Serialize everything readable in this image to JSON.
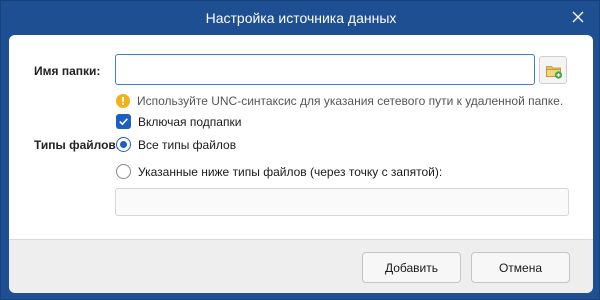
{
  "window": {
    "title": "Настройка источника данных"
  },
  "folder": {
    "label": "Имя папки:",
    "value": "",
    "placeholder": ""
  },
  "hint": {
    "text": "Используйте UNC-синтаксис для указания сетевого пути к удаленной папке."
  },
  "include_subfolders": {
    "label": "Включая подпапки",
    "checked": true
  },
  "file_types": {
    "label": "Типы файлов:",
    "option_all": "Все типы файлов",
    "option_specified": "Указанные ниже типы файлов (через точку с запятой):",
    "selected": "all",
    "specified_value": ""
  },
  "footer": {
    "add_label": "Добавить",
    "cancel_label": "Отмена"
  },
  "colors": {
    "titlebar": "#1d4f92",
    "accent": "#1c5fc0",
    "warning": "#f2b118"
  }
}
